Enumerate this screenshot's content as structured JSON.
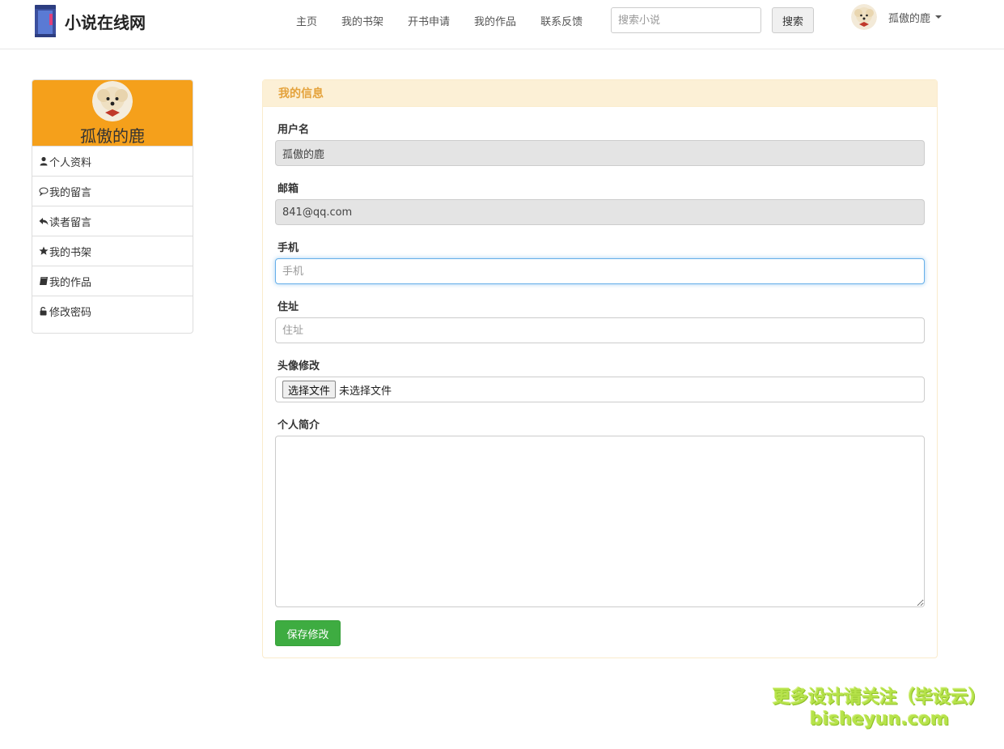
{
  "brand": {
    "name": "小说在线网"
  },
  "nav": {
    "items": [
      {
        "label": "主页"
      },
      {
        "label": "我的书架"
      },
      {
        "label": "开书申请"
      },
      {
        "label": "我的作品"
      },
      {
        "label": "联系反馈"
      }
    ]
  },
  "search": {
    "placeholder": "搜索小说",
    "button_label": "搜索"
  },
  "user": {
    "name": "孤傲的鹿"
  },
  "sidebar": {
    "profile_name": "孤傲的鹿",
    "header_color": "#f5a01b",
    "items": [
      {
        "label": "个人资料",
        "icon": "user-icon"
      },
      {
        "label": "我的留言",
        "icon": "comment-icon"
      },
      {
        "label": "读者留言",
        "icon": "reply-icon"
      },
      {
        "label": "我的书架",
        "icon": "star-icon"
      },
      {
        "label": "我的作品",
        "icon": "book-icon"
      },
      {
        "label": "修改密码",
        "icon": "unlock-icon"
      }
    ]
  },
  "panel": {
    "title": "我的信息",
    "username": {
      "label": "用户名",
      "value": "孤傲的鹿"
    },
    "email": {
      "label": "邮箱",
      "value": "841@qq.com"
    },
    "phone": {
      "label": "手机",
      "placeholder": "手机"
    },
    "address": {
      "label": "住址",
      "placeholder": "住址"
    },
    "avatar": {
      "label": "头像修改",
      "button_label": "选择文件",
      "status": "未选择文件"
    },
    "bio": {
      "label": "个人简介"
    },
    "save_label": "保存修改",
    "save_color": "#3eac41"
  },
  "watermark": {
    "line1": "更多设计请关注（毕设云）",
    "line2": "bisheyun.com"
  }
}
